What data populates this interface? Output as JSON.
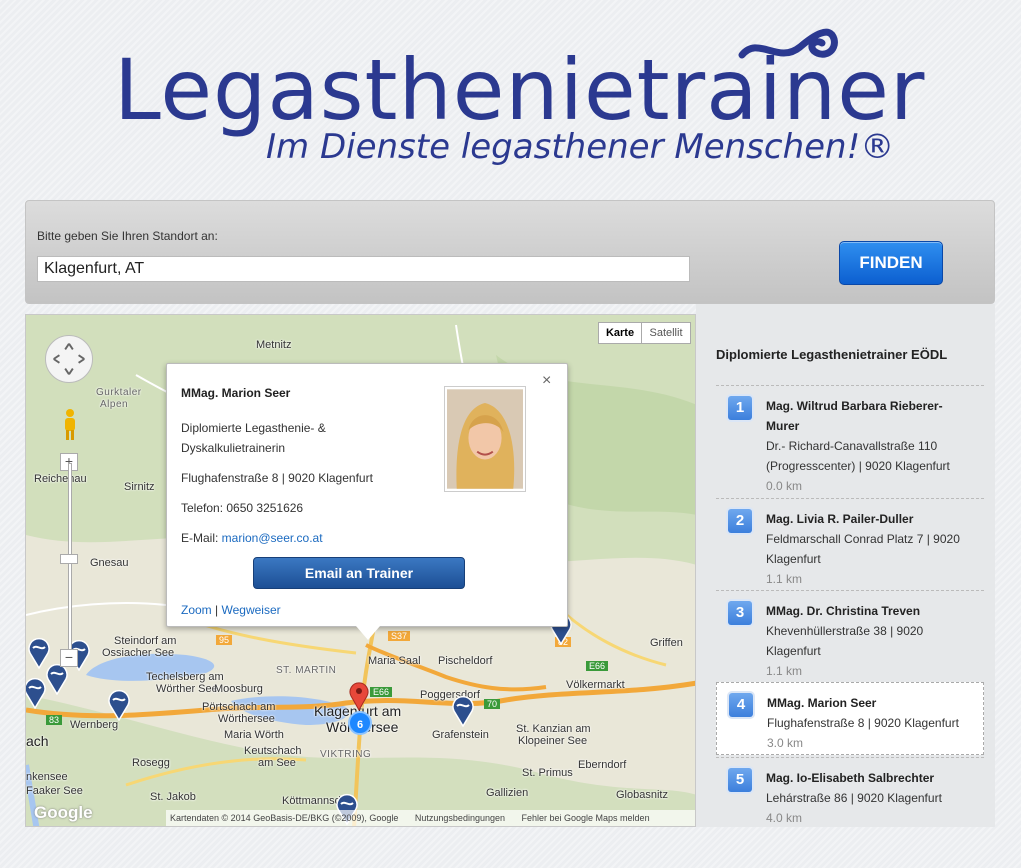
{
  "header": {
    "title": "Legasthenietrainer",
    "subtitle": "Im Dienste legasthener Menschen!®"
  },
  "search": {
    "label": "Bitte geben Sie Ihren Standort an:",
    "value": "Klagenfurt, AT",
    "button_label": "FINDEN"
  },
  "map": {
    "type_buttons": [
      "Karte",
      "Satellit"
    ],
    "zoom_in": "+",
    "zoom_out": "−",
    "cluster_count": "6",
    "attribution": [
      "Kartendaten © 2014 GeoBasis-DE/BKG (©2009), Google",
      "Nutzungsbedingungen",
      "Fehler bei Google Maps melden"
    ],
    "google_logo": "Google",
    "places": {
      "metnitz": "Metnitz",
      "gurktaler": "Gurktaler",
      "alpen": "Alpen",
      "reichenau": "Reichenau",
      "sirnitz": "Sirnitz",
      "gnesau": "Gnesau",
      "steindorf": "Steindorf am",
      "ossiacher": "Ossiacher See",
      "techelsberg": "Techelsberg am",
      "woerther_see": "Wörther See",
      "moosburg": "Moosburg",
      "poertschach": "Pörtschach am",
      "woerthersee": "Wörthersee",
      "wernberg": "Wernberg",
      "ach": "ach",
      "maria_woerth": "Maria Wörth",
      "keutschach": "Keutschach",
      "am_see": "am See",
      "rosegg": "Rosegg",
      "st_martin": "ST. MARTIN",
      "maria_saal": "Maria Saal",
      "pischeldorf": "Pischeldorf",
      "klagenfurt": "Klagenfurt am",
      "woerthersee_city": "Wörthersee",
      "viktring": "VIKTRING",
      "poggersdorf": "Poggersdorf",
      "grafenstein": "Grafenstein",
      "voelkermarkt": "Völkermarkt",
      "griffen": "Griffen",
      "st_kanzian": "St. Kanzian am",
      "klopeiner": "Klopeiner See",
      "eberndorf": "Eberndorf",
      "st_primus": "St. Primus",
      "gallizien": "Gallizien",
      "globasnitz": "Globasnitz",
      "koettmannsdorf": "Köttmannsdo",
      "st_jakob": "St. Jakob",
      "faaker": "Faaker See",
      "nkensee": "nkensee",
      "r_95": "95",
      "r_s37": "S37",
      "r_e66": "E66",
      "r_83": "83",
      "r_82": "82",
      "r_70": "70",
      "r_e66b": "E66"
    }
  },
  "info_window": {
    "name": "MMag. Marion Seer",
    "title_line1": "Diplomierte Legasthenie- &",
    "title_line2": "Dyskalkulietrainerin",
    "address": "Flughafenstraße 8 | 9020 Klagenfurt",
    "phone": "Telefon: 0650 3251626",
    "email_label": "E-Mail: ",
    "email": "marion@seer.co.at",
    "email_button": "Email an Trainer",
    "zoom_link": "Zoom",
    "separator": " | ",
    "directions_link": "Wegweiser",
    "close": "×"
  },
  "sidebar": {
    "title": "Diplomierte Legasthenietrainer EÖDL",
    "trainers": [
      {
        "num": "1",
        "name_line1": "Mag. Wiltrud Barbara Rieberer-",
        "name_line2": "Murer",
        "addr_line1": "Dr.- Richard-Canavallstraße 110",
        "addr_line2": "(Progresscenter) | 9020 Klagenfurt",
        "distance": "0.0 km"
      },
      {
        "num": "2",
        "name_line1": "Mag. Livia R. Pailer-Duller",
        "addr_line1": "Feldmarschall Conrad Platz 7 | 9020",
        "addr_line2": "Klagenfurt",
        "distance": "1.1 km"
      },
      {
        "num": "3",
        "name_line1": "MMag. Dr. Christina Treven",
        "addr_line1": "Khevenhüllerstraße 38 | 9020",
        "addr_line2": "Klagenfurt",
        "distance": "1.1 km"
      },
      {
        "num": "4",
        "name_line1": "MMag. Marion Seer",
        "addr_line1": "Flughafenstraße 8 | 9020 Klagenfurt",
        "distance": "3.0 km"
      },
      {
        "num": "5",
        "name_line1": "Mag. Io-Elisabeth Salbrechter",
        "addr_line1": "Lehárstraße 86 | 9020 Klagenfurt",
        "distance": "4.0 km"
      }
    ]
  }
}
